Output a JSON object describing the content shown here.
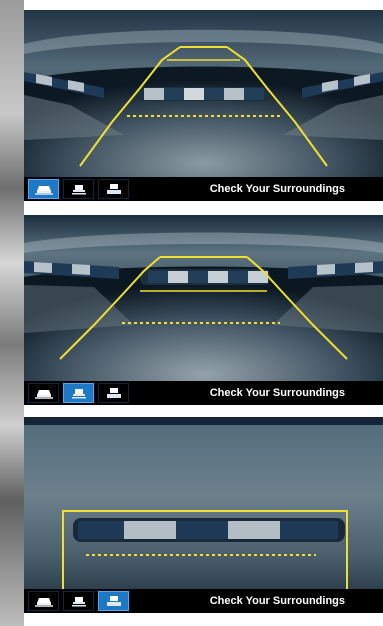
{
  "panels": [
    {
      "status_text": "Check Your Surroundings",
      "buttons": [
        {
          "icon": "wide-view-icon",
          "active": true
        },
        {
          "icon": "normal-view-icon",
          "active": false
        },
        {
          "icon": "top-down-view-icon",
          "active": false
        }
      ]
    },
    {
      "status_text": "Check Your Surroundings",
      "buttons": [
        {
          "icon": "wide-view-icon",
          "active": false
        },
        {
          "icon": "normal-view-icon",
          "active": true
        },
        {
          "icon": "top-down-view-icon",
          "active": false
        }
      ]
    },
    {
      "status_text": "Check Your Surroundings",
      "buttons": [
        {
          "icon": "wide-view-icon",
          "active": false
        },
        {
          "icon": "normal-view-icon",
          "active": false
        },
        {
          "icon": "top-down-view-icon",
          "active": true
        }
      ]
    }
  ],
  "colors": {
    "guide_line": "#f0df33",
    "active_button": "#1d78c6",
    "status_text": "#ffffff"
  }
}
